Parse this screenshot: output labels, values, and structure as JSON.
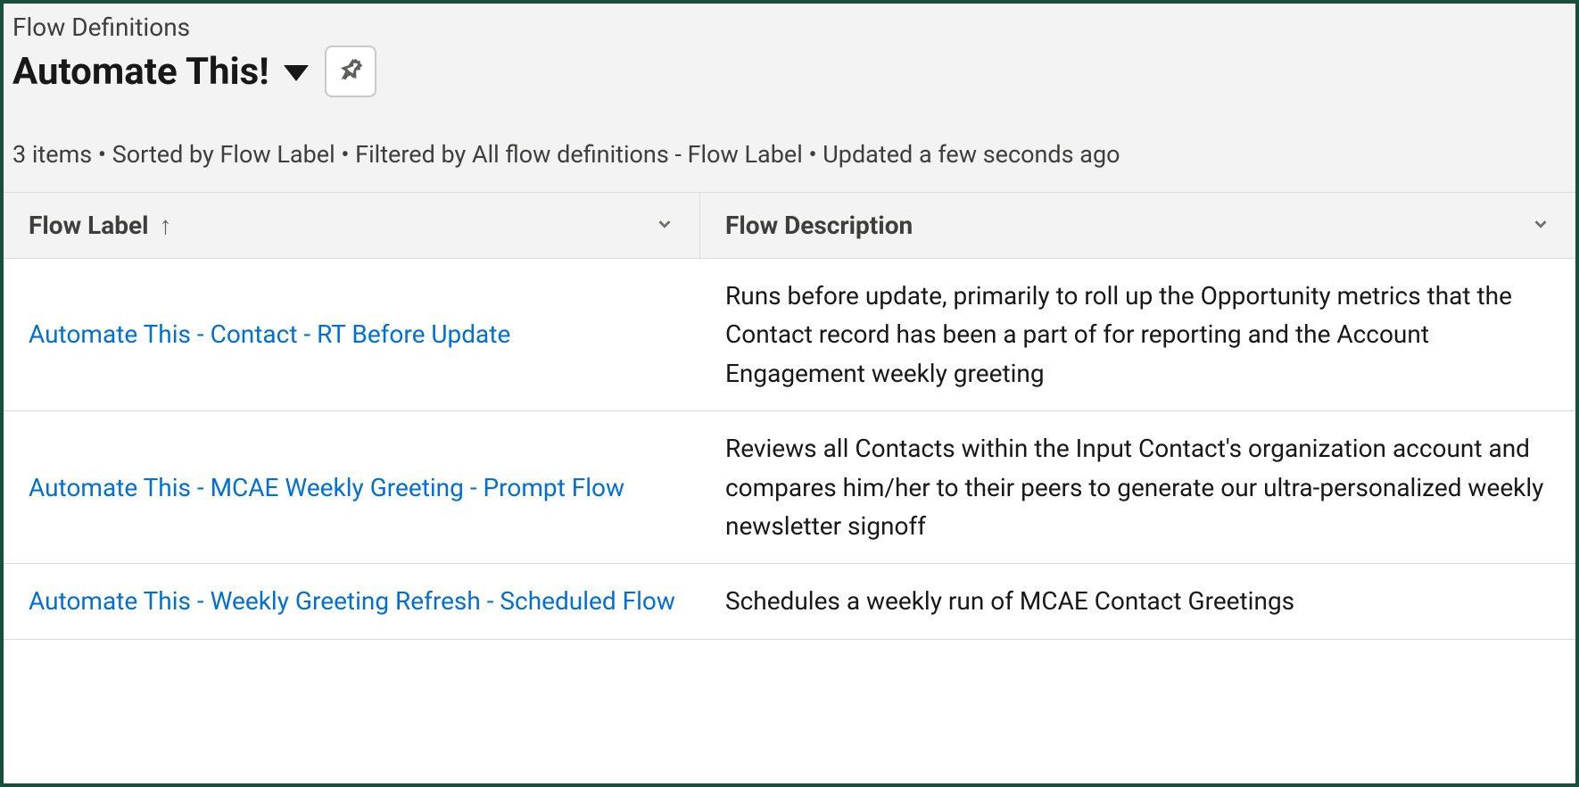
{
  "header": {
    "breadcrumb": "Flow Definitions",
    "title": "Automate This!",
    "status": "3 items • Sorted by Flow Label • Filtered by All flow definitions - Flow Label • Updated a few seconds ago"
  },
  "table": {
    "columns": [
      {
        "label": "Flow Label",
        "sorted": true
      },
      {
        "label": "Flow Description",
        "sorted": false
      }
    ],
    "rows": [
      {
        "label": "Automate This - Contact - RT Before Update",
        "description": "Runs before update, primarily to roll up the Opportunity metrics that the Contact record has been a part of for reporting and the Account Engagement weekly greeting"
      },
      {
        "label": "Automate This - MCAE Weekly Greeting - Prompt Flow",
        "description": "Reviews all Contacts within the Input Contact's organization account and compares him/her to their peers to generate our ultra-personalized weekly newsletter signoff"
      },
      {
        "label": "Automate This - Weekly Greeting Refresh - Scheduled Flow",
        "description": "Schedules a weekly run of MCAE Contact Greetings"
      }
    ]
  }
}
